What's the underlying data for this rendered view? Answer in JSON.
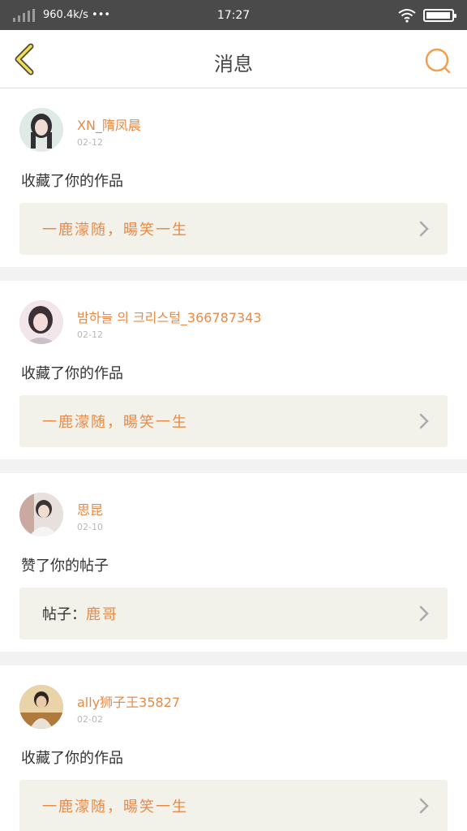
{
  "status_bar": {
    "net_speed": "960.4k/s •••",
    "time": "17:27",
    "signal_icon": "signal-bars-icon",
    "wifi_icon": "wifi-icon",
    "battery_icon": "battery-icon",
    "battery_level": 0.95
  },
  "header": {
    "title": "消息",
    "back_icon": "chevron-left-icon",
    "search_icon": "search-icon",
    "accent_color": "#f0a050"
  },
  "messages": [
    {
      "username": "XN_隋凤晨",
      "date": "02-12",
      "action": "收藏了你的作品",
      "ref_prefix": "",
      "ref_title": "一鹿濛随，暘笑一生"
    },
    {
      "username": "밤하늘 의 크리스털_366787343",
      "date": "02-12",
      "action": "收藏了你的作品",
      "ref_prefix": "",
      "ref_title": "一鹿濛随，暘笑一生"
    },
    {
      "username": "思昆",
      "date": "02-10",
      "action": "赞了你的帖子",
      "ref_prefix": "帖子：",
      "ref_title": "鹿哥"
    },
    {
      "username": "ally狮子王35827",
      "date": "02-02",
      "action": "收藏了你的作品",
      "ref_prefix": "",
      "ref_title": "一鹿濛随，暘笑一生"
    }
  ],
  "colors": {
    "username": "#e88a45",
    "ref_background": "#f2f1ea",
    "status_bar": "#4a4a4a"
  }
}
